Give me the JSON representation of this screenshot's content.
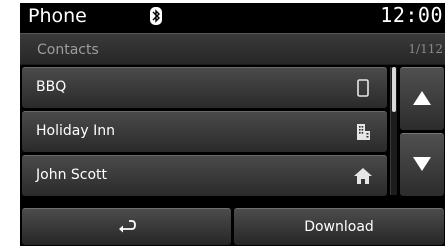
{
  "status_bar": {
    "title": "Phone",
    "bluetooth_icon": "bluetooth-icon",
    "time": "12:00"
  },
  "list": {
    "title": "Contacts",
    "page_indicator": "1/112",
    "contacts": [
      {
        "label": "BBQ",
        "icon": "mobile-phone-icon"
      },
      {
        "label": "Holiday Inn",
        "icon": "office-building-icon"
      },
      {
        "label": "John Scott",
        "icon": "home-icon"
      }
    ]
  },
  "scroll": {
    "up_icon": "arrow-up-icon",
    "down_icon": "arrow-down-icon"
  },
  "bottom_bar": {
    "back_icon": "back-arrow-icon",
    "download_label": "Download"
  },
  "colors": {
    "background": "#000000",
    "text": "#ffffff",
    "muted_text": "#9d9d9d"
  }
}
